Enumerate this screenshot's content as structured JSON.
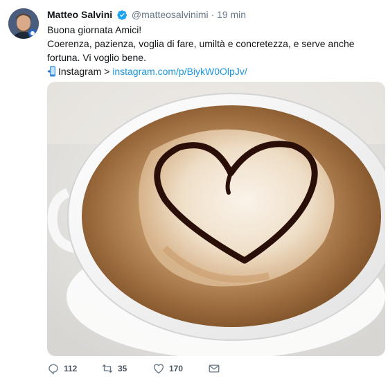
{
  "user": {
    "name": "Matteo Salvini",
    "handle": "@matteosalvinimi",
    "separator": "·",
    "time": "19 min"
  },
  "tweet": {
    "line1": "Buona giornata Amici!",
    "line2": "Coerenza, pazienza, voglia di fare, umiltà e concretezza, e serve anche fortuna. Vi voglio bene.",
    "ig_label": "Instagram >",
    "ig_link": "instagram.com/p/BiykW0OlpJv/"
  },
  "actions": {
    "replies": "112",
    "retweets": "35",
    "likes": "170"
  },
  "colors": {
    "link": "#1b95e0",
    "verified": "#1da1f2",
    "muted": "#657786"
  }
}
